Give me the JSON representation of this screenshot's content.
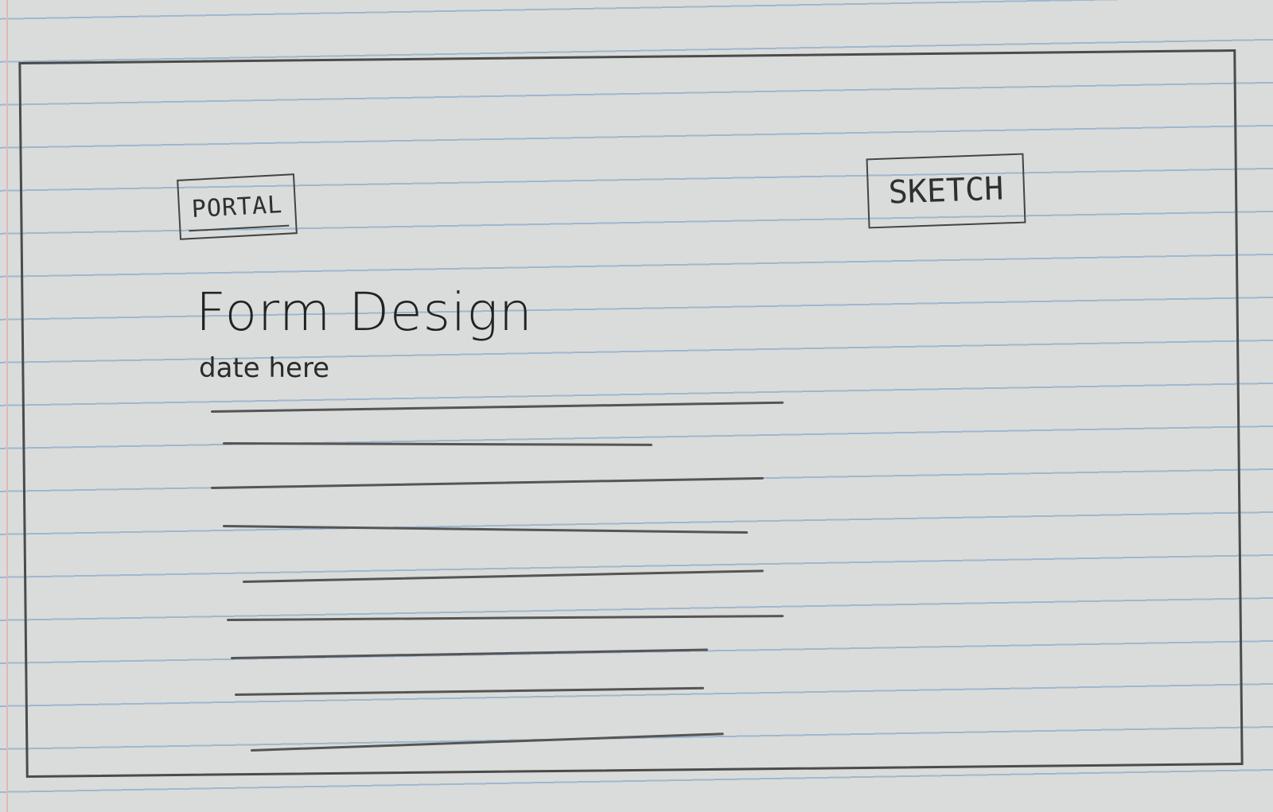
{
  "header": {
    "logo_label": "PORTAL",
    "sketch_button_label": "SKETCH"
  },
  "main": {
    "title": "Form Design",
    "date": "date here"
  },
  "colors": {
    "paper": "#d9dcda",
    "rule": "#9fb7cf",
    "pencil": "#444444"
  }
}
